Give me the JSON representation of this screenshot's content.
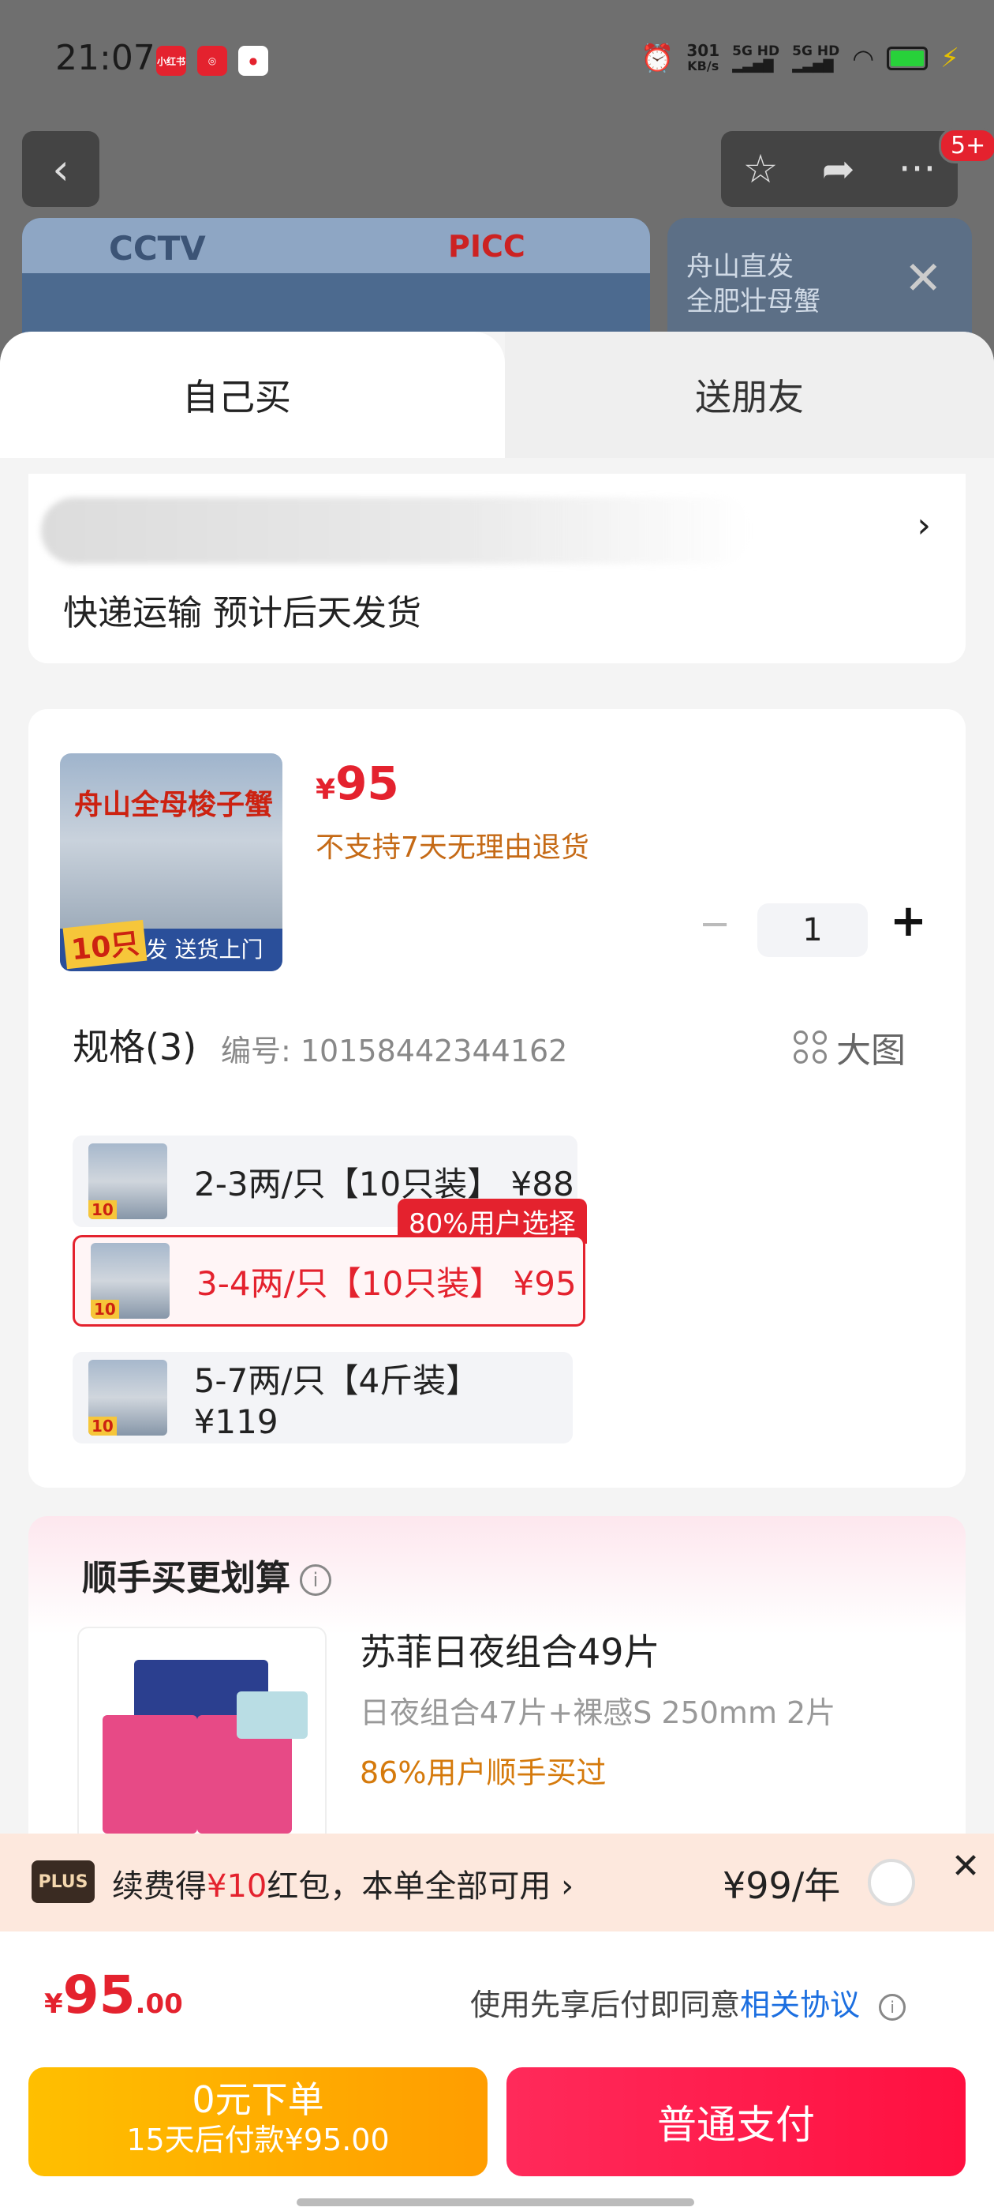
{
  "status": {
    "time": "21:07",
    "speed_value": "301",
    "speed_unit": "KB/s",
    "sig1": "5G HD",
    "sig2": "5G HD"
  },
  "nav": {
    "badge": "5+"
  },
  "banner": {
    "cctv": "CCTV",
    "picc": "PICC",
    "side_text": "舟山直发\n全肥壮母蟹"
  },
  "tabs": {
    "self": "自己买",
    "friend": "送朋友"
  },
  "address": {
    "arrow": "›",
    "delivery": "快递运输 预计后天发货"
  },
  "product": {
    "img_title": "舟山全母梭子蟹",
    "img_bottom": "码头直发 送货上门",
    "img_count": "10只",
    "price_symbol": "¥",
    "price": "95",
    "no_return": "不支持7天无理由退货",
    "qty_minus": "−",
    "qty": "1",
    "qty_plus": "+"
  },
  "specs": {
    "title": "规格(3)",
    "code": "编号: 10158442344162",
    "big_pic": "大图",
    "tag": "80%用户选择",
    "items": [
      {
        "label": "2-3两/只【10只装】 ¥88"
      },
      {
        "label": "3-4两/只【10只装】 ¥95"
      },
      {
        "label": "5-7两/只【4斤装】 ¥119"
      }
    ]
  },
  "combo": {
    "title": "顺手买更划算",
    "info_icon": "i",
    "name": "苏菲日夜组合49片",
    "sub": "日夜组合47片+裸感S 250mm 2片",
    "rate": "86%用户顺手买过"
  },
  "plus": {
    "logo": "PLUS",
    "text_pre": "续费得",
    "amount": "¥10",
    "text_post": "红包，本单全部可用 ›",
    "price": "¥99/年",
    "close": "✕"
  },
  "total": {
    "sym": "¥",
    "int": "95",
    "dec": ".00",
    "agree_pre": "使用先享后付即同意",
    "agree_link": "相关协议",
    "info_icon": "i"
  },
  "pay": {
    "later_l1": "0元下单",
    "later_l2": "15天后付款¥95.00",
    "normal": "普通支付"
  },
  "colors": {
    "accent_red": "#e4222e",
    "orange": "#ff9d00",
    "link_blue": "#1c6fe0"
  }
}
